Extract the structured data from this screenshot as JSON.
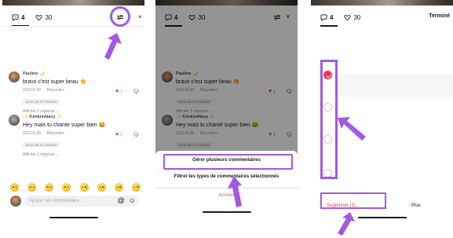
{
  "colors": {
    "accent": "#fe2c55",
    "highlight": "#a259e6",
    "text": "#161823",
    "muted": "#8a8b91"
  },
  "tabs": {
    "comments_count": "4",
    "likes_count": "30"
  },
  "comments": [
    {
      "user": "Pauline 🌙",
      "text": "bravo c'est super beau 👏",
      "date": "2022-6-29",
      "reply": "Répondre",
      "badge": "Aimé par le créateur",
      "replies": "Afficher 1 réponse ⌄",
      "likes": "1"
    },
    {
      "user": "✨ KimkimNavy ✨",
      "text": "Hey mais tu chante super bien 😂",
      "date": "2022-6-29",
      "reply": "Répondre",
      "badge": "Aimé par le créateur",
      "replies": "Afficher 1 réponse ⌄",
      "likes": "1"
    }
  ],
  "emojis": [
    "grinning-emoji",
    "heart-eyes-emoji",
    "joy-emoji",
    "surprised-emoji",
    "smile-emoji",
    "grin-emoji",
    "sweat-emoji",
    "smiley-emoji"
  ],
  "input": {
    "placeholder": "Ajouter un commentaire...",
    "mention_icon": "@",
    "emoji_icon": "☺"
  },
  "action_sheet": {
    "manage": "Gérer plusieurs commentaires",
    "filter": "Filtrer les types de commentaires sélectionnés",
    "cancel": "Annuler"
  },
  "select_mode": {
    "done": "Terminé",
    "delete": "Supprimer (1)",
    "more": "Plus",
    "checked": [
      true,
      false,
      false,
      false
    ]
  }
}
